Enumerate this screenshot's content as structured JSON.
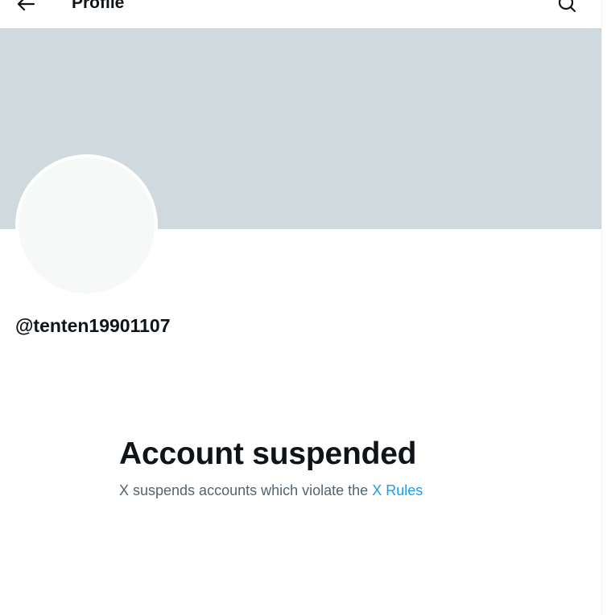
{
  "header": {
    "title": "Profile",
    "back_icon": "arrow-left-icon",
    "search_icon": "search-icon"
  },
  "profile": {
    "handle": "@tenten19901107"
  },
  "suspension": {
    "title": "Account suspended",
    "message": "X suspends accounts which violate the",
    "link_text": "X Rules"
  },
  "colors": {
    "banner": "#cfd9de",
    "avatar": "#f7f9f9",
    "text_primary": "#0f1419",
    "text_secondary": "#536471",
    "link": "#1d9bf0"
  }
}
